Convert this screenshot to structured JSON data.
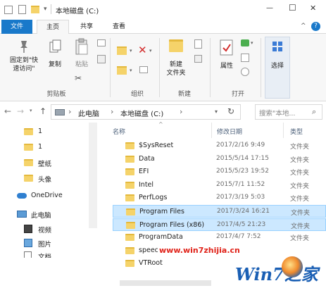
{
  "titlebar": {
    "title": "本地磁盘 (C:)",
    "minimize": "—",
    "maximize": "☐",
    "close": "✕"
  },
  "menu": {
    "file": "文件",
    "home": "主页",
    "share": "共享",
    "view": "查看",
    "help": "?",
    "collapse": "^"
  },
  "ribbon": {
    "pin": "固定到\"快\n速访问\"",
    "copy": "复制",
    "paste": "粘贴",
    "new_folder": "新建\n文件夹",
    "properties": "属性",
    "select": "选择",
    "grp_clipboard": "剪贴板",
    "grp_organize": "组织",
    "grp_new": "新建",
    "grp_open": "打开"
  },
  "address": {
    "back": "←",
    "forward": "→",
    "up": "↑",
    "root_sep": "›",
    "pc": "此电脑",
    "drive": "本地磁盘 (C:)",
    "chev": "›",
    "refresh": "↻",
    "search_placeholder": "搜索\"本地..."
  },
  "nav": [
    {
      "label": "1",
      "type": "folder"
    },
    {
      "label": "1",
      "type": "folder"
    },
    {
      "label": "壁纸",
      "type": "folder"
    },
    {
      "label": "头像",
      "type": "folder"
    },
    {
      "label": "OneDrive",
      "type": "cloud"
    },
    {
      "label": "此电脑",
      "type": "pc"
    },
    {
      "label": "视频",
      "type": "video"
    },
    {
      "label": "图片",
      "type": "picture"
    },
    {
      "label": "文档",
      "type": "doc"
    }
  ],
  "columns": {
    "name": "名称",
    "date": "修改日期",
    "type": "类型"
  },
  "files": [
    {
      "name": "$SysReset",
      "date": "2017/2/16 9:49",
      "type": "文件夹"
    },
    {
      "name": "Data",
      "date": "2015/5/14 17:15",
      "type": "文件夹"
    },
    {
      "name": "EFI",
      "date": "2015/5/23 19:52",
      "type": "文件夹"
    },
    {
      "name": "Intel",
      "date": "2015/7/1 11:52",
      "type": "文件夹"
    },
    {
      "name": "PerfLogs",
      "date": "2017/3/19 5:03",
      "type": "文件夹"
    },
    {
      "name": "Program Files",
      "date": "2017/3/24 16:21",
      "type": "文件夹"
    },
    {
      "name": "Program Files (x86)",
      "date": "2017/4/5 21:23",
      "type": "文件夹"
    },
    {
      "name": "ProgramData",
      "date": "2017/4/7 7:52",
      "type": "文件夹"
    },
    {
      "name": "speech",
      "date": "",
      "type": ""
    },
    {
      "name": "VTRoot",
      "date": "",
      "type": ""
    }
  ],
  "watermark": {
    "url": "www.win7zhijia.cn",
    "logo": "Win7之家"
  }
}
